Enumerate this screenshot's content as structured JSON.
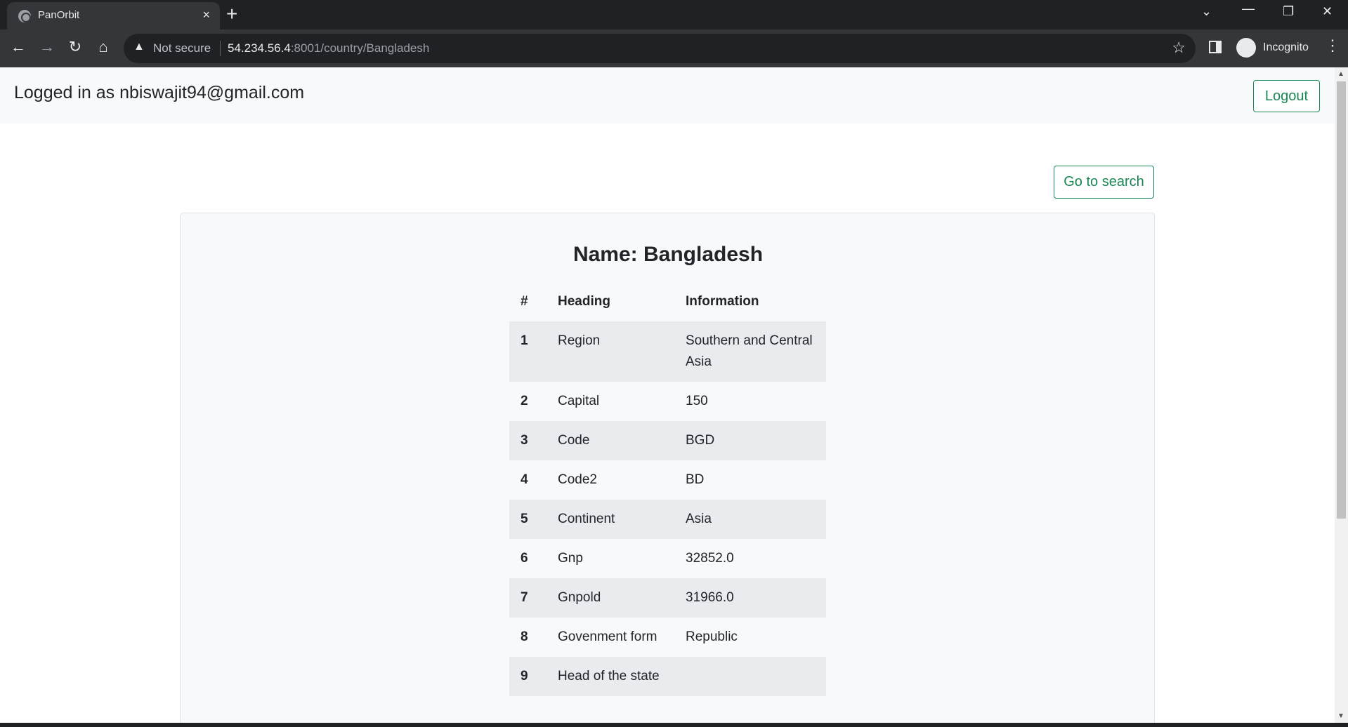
{
  "browser": {
    "tab_title": "PanOrbit",
    "tab_close": "×",
    "new_tab": "+",
    "security_label": "Not secure",
    "url_host": "54.234.56.4",
    "url_path": ":8001/country/Bangladesh",
    "profile_label": "Incognito"
  },
  "navbar": {
    "logged_in_text": "Logged in as nbiswajit94@gmail.com",
    "logout_label": "Logout"
  },
  "page": {
    "search_button_label": "Go to search",
    "card_title": "Name: Bangladesh",
    "table": {
      "headers": [
        "#",
        "Heading",
        "Information"
      ],
      "rows": [
        {
          "num": "1",
          "heading": "Region",
          "info": "Southern and Central Asia"
        },
        {
          "num": "2",
          "heading": "Capital",
          "info": "150"
        },
        {
          "num": "3",
          "heading": "Code",
          "info": "BGD"
        },
        {
          "num": "4",
          "heading": "Code2",
          "info": "BD"
        },
        {
          "num": "5",
          "heading": "Continent",
          "info": "Asia"
        },
        {
          "num": "6",
          "heading": "Gnp",
          "info": "32852.0"
        },
        {
          "num": "7",
          "heading": "Gnpold",
          "info": "31966.0"
        },
        {
          "num": "8",
          "heading": "Govenment form",
          "info": "Republic"
        },
        {
          "num": "9",
          "heading": "Head of the state",
          "info": ""
        }
      ]
    }
  },
  "colors": {
    "accent": "#198754",
    "stripe": "#e9ecef",
    "navbar_bg": "#f8f9fa"
  }
}
